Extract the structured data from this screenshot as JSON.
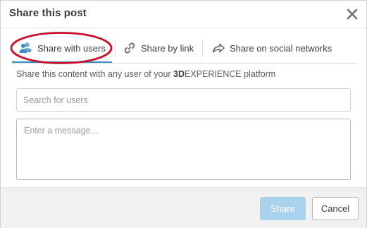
{
  "dialog": {
    "title": "Share this post",
    "close_icon": "close-icon"
  },
  "tabs": [
    {
      "label": "Share with users",
      "icon": "users-icon",
      "active": true
    },
    {
      "label": "Share by link",
      "icon": "link-icon",
      "active": false
    },
    {
      "label": "Share on social networks",
      "icon": "share-arrow-icon",
      "active": false
    }
  ],
  "description": {
    "prefix": "Share this content with any user of your ",
    "brand_bold": "3D",
    "brand_rest": "EXPERIENCE",
    "suffix": " platform"
  },
  "search": {
    "placeholder": "Search for users",
    "value": ""
  },
  "message": {
    "placeholder": "Enter a message...",
    "value": ""
  },
  "footer": {
    "share_label": "Share",
    "cancel_label": "Cancel"
  },
  "colors": {
    "accent": "#368ec4",
    "share_button_disabled": "#a9d2ee",
    "highlight_annotation": "#c8102e"
  }
}
